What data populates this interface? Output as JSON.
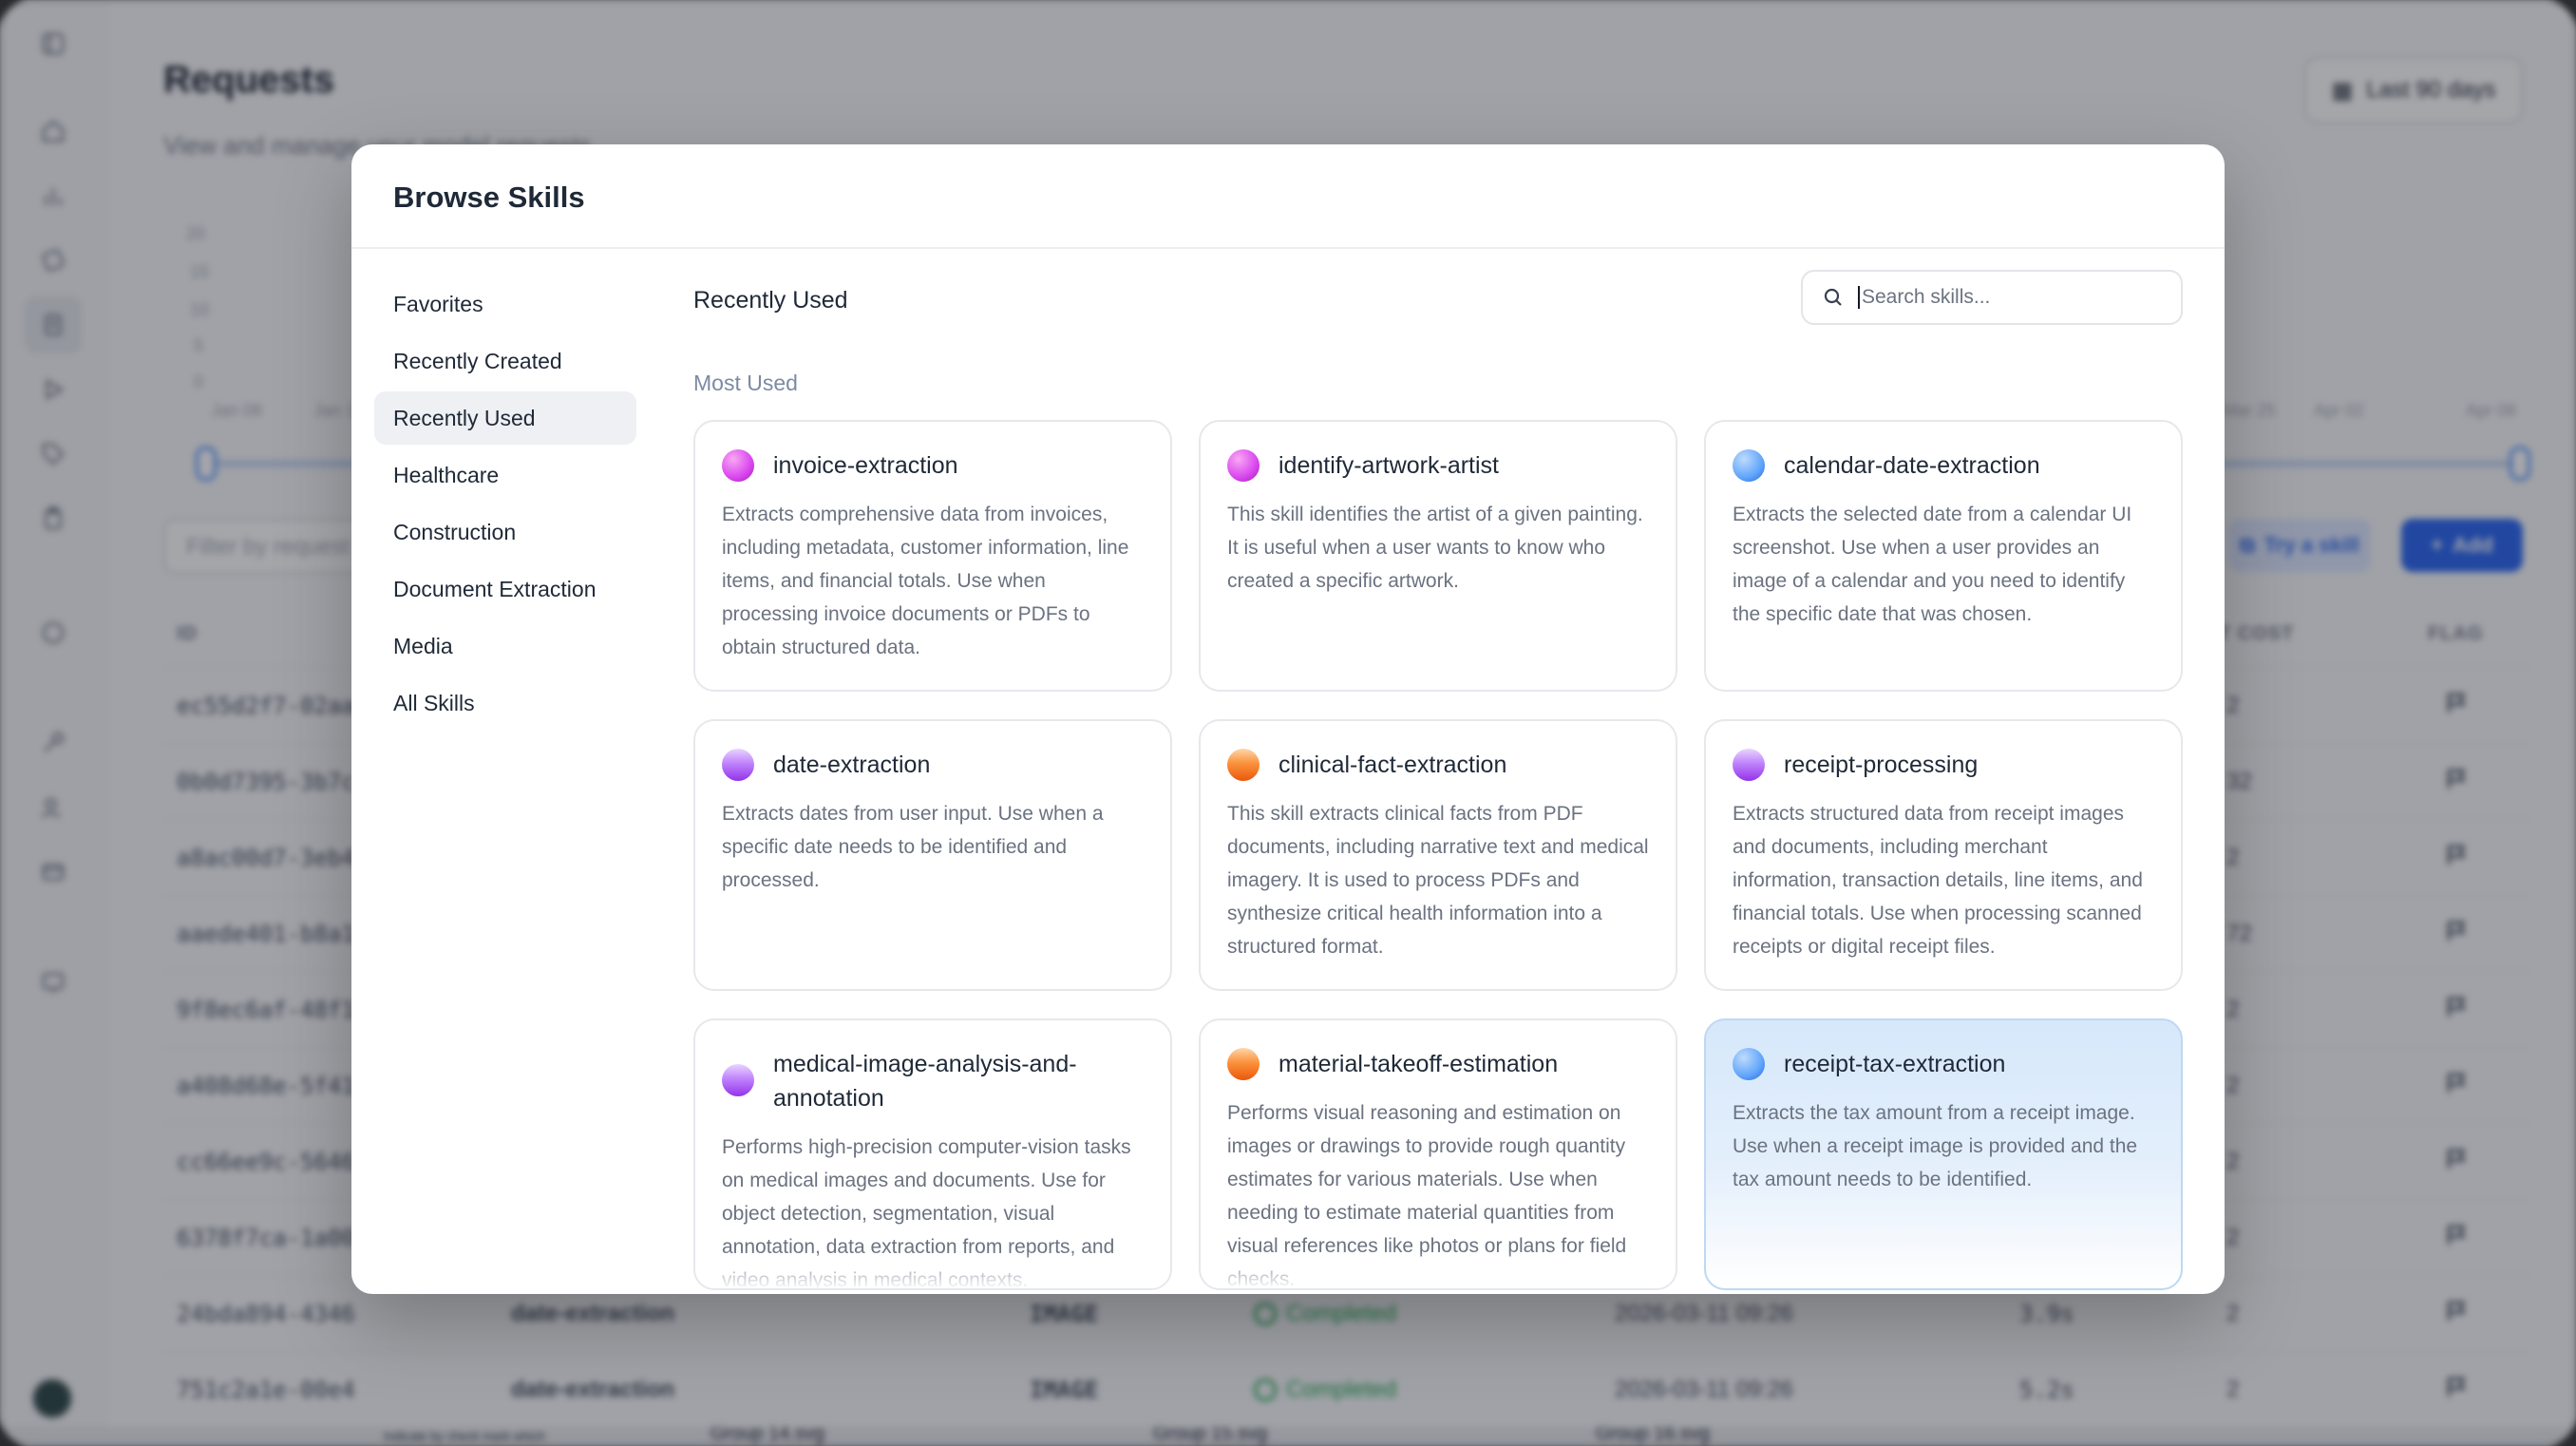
{
  "background": {
    "title": "Requests",
    "subtitle": "View and manage your model requests",
    "date_range": "Last 90 days",
    "y_ticks": [
      "20",
      "15",
      "10",
      "5",
      "0"
    ],
    "x_ticks_left": [
      "Jan 08",
      "Jan 1"
    ],
    "x_ticks_right": [
      "Mar 25",
      "Apr 02",
      "Apr 08"
    ],
    "filter_placeholder": "Filter by request",
    "try_skill_label": "Try a skill",
    "add_label": "Add",
    "columns": [
      "ID",
      "T COST",
      "FLAG"
    ],
    "rows": [
      {
        "id": "ec55d2f7-02aa",
        "cost": "2"
      },
      {
        "id": "0b0d7395-3b7c",
        "cost": "32"
      },
      {
        "id": "a8ac00d7-3eb4",
        "cost": "2"
      },
      {
        "id": "aaede401-b8a1",
        "cost": "72"
      },
      {
        "id": "9f8ec6af-48f1",
        "cost": "2"
      },
      {
        "id": "a408d68e-5f41",
        "cost": "2"
      },
      {
        "id": "cc66ee9c-5646",
        "cost": "2"
      },
      {
        "id": "6378f7ca-1a00",
        "cost": "2"
      },
      {
        "id": "24bda894-4346",
        "skill": "date-extraction",
        "type": "IMAGE",
        "status": "Completed",
        "time": "2026-03-11 09:26",
        "dur": "3.9s",
        "cost": "2"
      },
      {
        "id": "751c2a1e-00e4",
        "skill": "date-extraction",
        "type": "IMAGE",
        "status": "Completed",
        "time": "2026-03-11 09:26",
        "dur": "5.2s",
        "cost": "2"
      }
    ],
    "bottom_strip": [
      "Indicate by check mark which",
      "Group 14.svg",
      "Group 15.svg",
      "Group 16.svg"
    ]
  },
  "modal": {
    "title": "Browse Skills",
    "categories": [
      {
        "label": "Favorites",
        "active": false
      },
      {
        "label": "Recently Created",
        "active": false
      },
      {
        "label": "Recently Used",
        "active": true
      },
      {
        "label": "Healthcare",
        "active": false
      },
      {
        "label": "Construction",
        "active": false
      },
      {
        "label": "Document Extraction",
        "active": false
      },
      {
        "label": "Media",
        "active": false
      },
      {
        "label": "All Skills",
        "active": false
      }
    ],
    "section_title": "Recently Used",
    "search_placeholder": "Search skills...",
    "group_title": "Most Used",
    "skills": [
      {
        "name": "invoice-extraction",
        "orb": "pink",
        "desc": "Extracts comprehensive data from invoices, including metadata, customer information, line items, and financial totals. Use when processing invoice documents or PDFs to obtain structured data."
      },
      {
        "name": "identify-artwork-artist",
        "orb": "pink",
        "desc": "This skill identifies the artist of a given painting. It is useful when a user wants to know who created a specific artwork."
      },
      {
        "name": "calendar-date-extraction",
        "orb": "blue",
        "desc": "Extracts the selected date from a calendar UI screenshot. Use when a user provides an image of a calendar and you need to identify the specific date that was chosen."
      },
      {
        "name": "date-extraction",
        "orb": "purple",
        "desc": "Extracts dates from user input. Use when a specific date needs to be identified and processed."
      },
      {
        "name": "clinical-fact-extraction",
        "orb": "orange",
        "desc": "This skill extracts clinical facts from PDF documents, including narrative text and medical imagery. It is used to process PDFs and synthesize critical health information into a structured format."
      },
      {
        "name": "receipt-processing",
        "orb": "purple",
        "desc": "Extracts structured data from receipt images and documents, including merchant information, transaction details, line items, and financial totals. Use when processing scanned receipts or digital receipt files."
      },
      {
        "name": "medical-image-analysis-and-annotation",
        "orb": "purple",
        "desc": "Performs high-precision computer-vision tasks on medical images and documents. Use for object detection, segmentation, visual annotation, data extraction from reports, and video analysis in medical contexts."
      },
      {
        "name": "material-takeoff-estimation",
        "orb": "orange",
        "desc": "Performs visual reasoning and estimation on images or drawings to provide rough quantity estimates for various materials. Use when needing to estimate material quantities from visual references like photos or plans for field checks."
      },
      {
        "name": "receipt-tax-extraction",
        "orb": "blue",
        "highlighted": true,
        "desc": "Extracts the tax amount from a receipt image. Use when a receipt image is provided and the tax amount needs to be identified."
      }
    ]
  }
}
